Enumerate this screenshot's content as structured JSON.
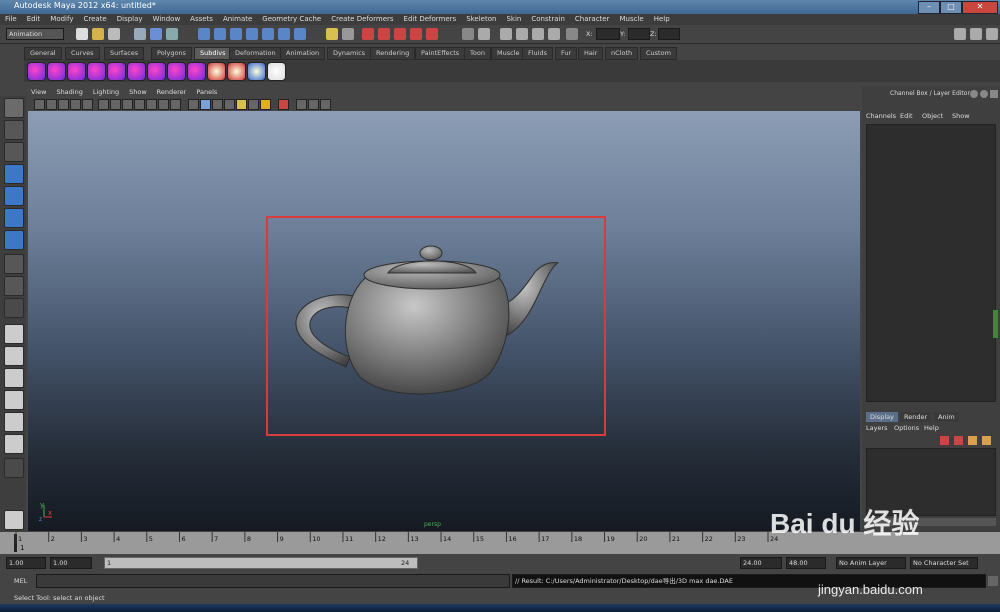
{
  "window": {
    "title": "Autodesk Maya 2012 x64: untitled*",
    "min": "–",
    "max": "□",
    "close": "✕"
  },
  "menu": [
    "File",
    "Edit",
    "Modify",
    "Create",
    "Display",
    "Window",
    "Assets",
    "Animate",
    "Geometry Cache",
    "Create Deformers",
    "Edit Deformers",
    "Skeleton",
    "Skin",
    "Constrain",
    "Character",
    "Muscle",
    "Help"
  ],
  "status_line": {
    "mode": "Animation",
    "x_label": "X:",
    "y_label": "Y:",
    "z_label": "Z:"
  },
  "shelf": {
    "tabs": [
      "General",
      "Curves",
      "Surfaces",
      "Polygons",
      "Subdivs",
      "Deformation",
      "Animation",
      "Dynamics",
      "Rendering",
      "PaintEffects",
      "Toon",
      "Muscle",
      "Fluids",
      "Fur",
      "Hair",
      "nCloth",
      "Custom"
    ],
    "active": "Subdivs"
  },
  "panel": {
    "menus": [
      "View",
      "Shading",
      "Lighting",
      "Show",
      "Renderer",
      "Panels"
    ]
  },
  "viewport": {
    "axis_x": "x",
    "axis_y": "y",
    "axis_z": "z",
    "camera": "persp"
  },
  "channel_box": {
    "title": "Channel Box / Layer Editor",
    "menus": [
      "Channels",
      "Edit",
      "Object",
      "Show"
    ],
    "layer_tabs": [
      "Display",
      "Render",
      "Anim"
    ],
    "active_layer_tab": "Display",
    "layer_menus": [
      "Layers",
      "Options",
      "Help"
    ]
  },
  "timeline": {
    "ticks": [
      "1",
      "2",
      "3",
      "4",
      "5",
      "6",
      "7",
      "8",
      "9",
      "10",
      "11",
      "12",
      "13",
      "14",
      "15",
      "16",
      "17",
      "18",
      "19",
      "20",
      "21",
      "22",
      "23",
      "24"
    ],
    "current_frame": "1"
  },
  "range": {
    "start": "1.00",
    "start2": "1.00",
    "slider_start": "1",
    "slider_end": "24",
    "end": "24.00",
    "end2": "48.00",
    "anim_layer": "No Anim Layer",
    "char_set": "No Character Set"
  },
  "command": {
    "label": "MEL",
    "result": "// Result: C:/Users/Administrator/Desktop/dae导出/3D max dae.DAE"
  },
  "help_line": "Select Tool: select an object",
  "watermark": {
    "brand": "Bai du 经验",
    "url": "jingyan.baidu.com"
  },
  "colors": {
    "accent_select": "#d93a3a",
    "title_bar": "#4a74a0"
  }
}
